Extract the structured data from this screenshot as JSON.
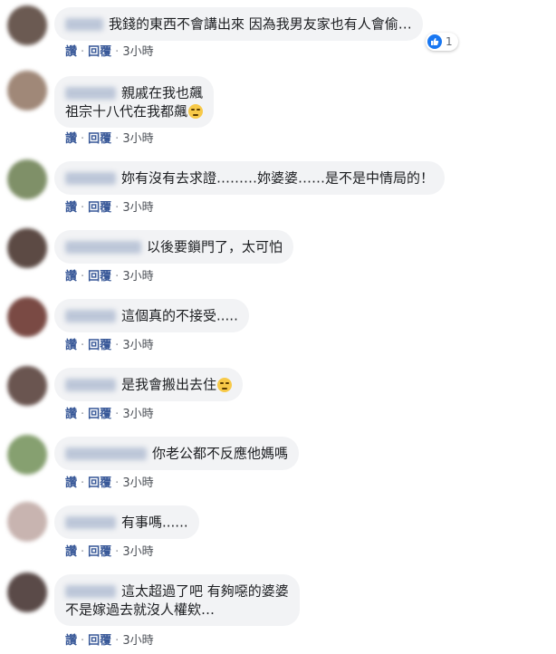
{
  "actions": {
    "like_label": "讚",
    "reply_label": "回覆",
    "separator": "·"
  },
  "comments": [
    {
      "text": "我錢的東西不會講出來 因為我男友家也有人會偷…",
      "time": "3小時",
      "avatar_color": "#6b5a52",
      "reaction_count": "1"
    },
    {
      "line1": "親戚在我也飆",
      "line2": "祖宗十八代在我都飆",
      "time": "3小時",
      "avatar_color": "#a08878"
    },
    {
      "text": "妳有沒有去求證………妳婆婆……是不是中情局的！",
      "time": "3小時",
      "avatar_color": "#7f9068"
    },
    {
      "text": "以後要鎖門了，太可怕",
      "time": "3小時",
      "avatar_color": "#5c4a44"
    },
    {
      "text": "這個真的不接受.....",
      "time": "3小時",
      "avatar_color": "#7a4a44"
    },
    {
      "text": "是我會搬出去住",
      "time": "3小時",
      "avatar_color": "#6a5550"
    },
    {
      "text": "你老公都不反應他媽嗎",
      "time": "3小時",
      "avatar_color": "#86a070"
    },
    {
      "text": "有事嗎......",
      "time": "3小時",
      "avatar_color": "#c8b4b0"
    },
    {
      "line1": "這太超過了吧 有夠噁的婆婆",
      "line2": "不是嫁過去就沒人權欸…",
      "time": "3小時",
      "avatar_color": "#5a4a48"
    }
  ]
}
